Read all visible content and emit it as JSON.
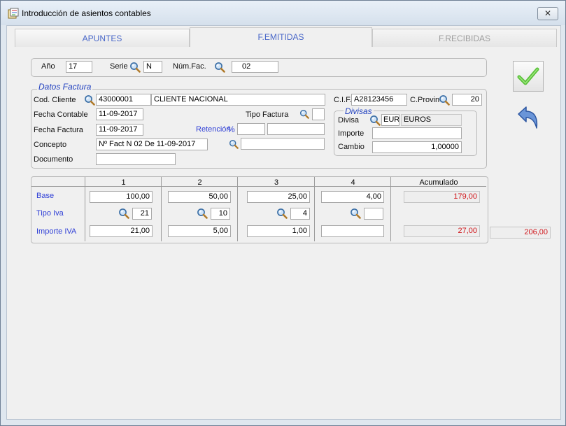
{
  "window": {
    "title": "Introducción de asientos contables",
    "close_label": "✕"
  },
  "tabs": [
    {
      "label": "APUNTES",
      "state": "inactive"
    },
    {
      "label": "F.EMITIDAS",
      "state": "active"
    },
    {
      "label": "F.RECIBIDAS",
      "state": "disabled"
    }
  ],
  "header": {
    "anio_label": "Año",
    "anio_value": "17",
    "serie_label": "Serie",
    "serie_value": "N",
    "numfac_label": "Núm.Fac.",
    "numfac_value": "02"
  },
  "datos_factura": {
    "group_title": "Datos Factura",
    "cod_cliente_label": "Cod. Cliente",
    "cod_cliente_value": "43000001",
    "cliente_nombre": "CLIENTE NACIONAL",
    "cif_label": "C.I.F.",
    "cif_value": "A28123456",
    "cprovin_label": "C.Provin",
    "cprovin_value": "20",
    "fecha_contable_label": "Fecha Contable",
    "fecha_contable_value": "11-09-2017",
    "tipo_factura_label": "Tipo Factura",
    "tipo_factura_value": "",
    "fecha_factura_label": "Fecha Factura",
    "fecha_factura_value": "11-09-2017",
    "retencion_label": "Retención",
    "retencion_symbol": "%",
    "retencion_pct": "",
    "retencion_importe": "",
    "concepto_label": "Concepto",
    "concepto_value": "Nº Fact N 02 De 11-09-2017",
    "concepto_extra": "",
    "documento_label": "Documento",
    "documento_value": ""
  },
  "divisas": {
    "group_title": "Divisas",
    "divisa_label": "Divisa",
    "divisa_code": "EUR",
    "divisa_name": "EUROS",
    "importe_label": "Importe",
    "importe_value": "",
    "cambio_label": "Cambio",
    "cambio_value": "1,00000"
  },
  "grid": {
    "columns": [
      "1",
      "2",
      "3",
      "4"
    ],
    "acumulado_label": "Acumulado",
    "base_label": "Base",
    "tipo_iva_label": "Tipo Iva",
    "importe_iva_label": "Importe IVA",
    "base": [
      "100,00",
      "50,00",
      "25,00",
      "4,00"
    ],
    "tipo_iva": [
      "21",
      "10",
      "4",
      ""
    ],
    "importe_iva": [
      "21,00",
      "5,00",
      "1,00",
      ""
    ],
    "acumulado_base": "179,00",
    "acumulado_iva": "27,00",
    "total": "206,00"
  },
  "icons": {
    "accept": "checkmark-icon",
    "back": "undo-arrow-icon",
    "lookup": "magnifier-icon",
    "accent_color": "#2f3fd6",
    "total_color": "#d0161b"
  }
}
